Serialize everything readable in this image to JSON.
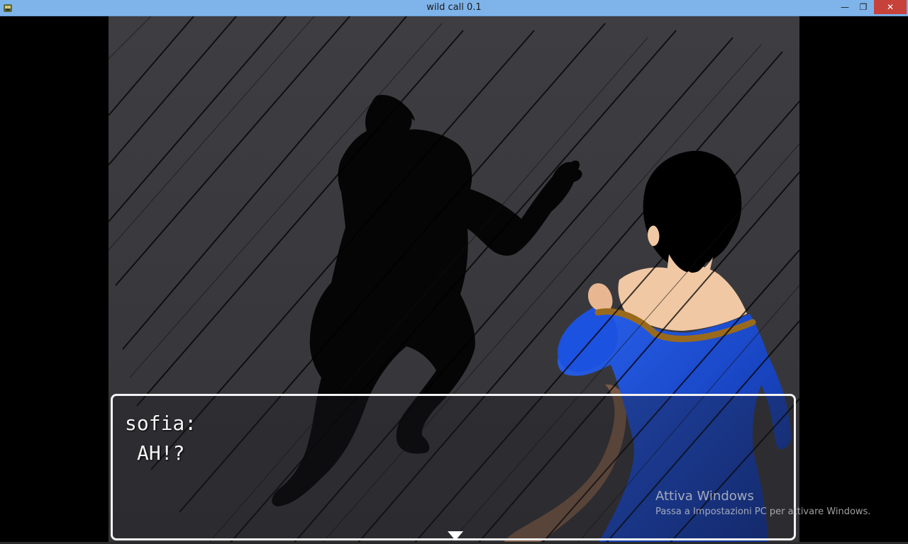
{
  "window": {
    "title": "wild call 0.1",
    "minimize_glyph": "—",
    "restore_glyph": "❐",
    "close_glyph": "✕"
  },
  "dialog": {
    "speaker": "sofia:",
    "text": "AH!?"
  },
  "watermark": {
    "title": "Attiva Windows",
    "subtitle": "Passa a Impostazioni PC per attivare Windows."
  },
  "icons": {
    "app": "game-app-icon",
    "advance": "triangle-down-icon"
  },
  "colors": {
    "titlebar": "#7eb4ea",
    "close_button": "#c7423a",
    "scene_bg": "#3a3a3e",
    "dress": "#1d4fd6",
    "skin": "#f1c8a4",
    "hair": "#000000",
    "dialog_border": "#f2f2f2"
  }
}
